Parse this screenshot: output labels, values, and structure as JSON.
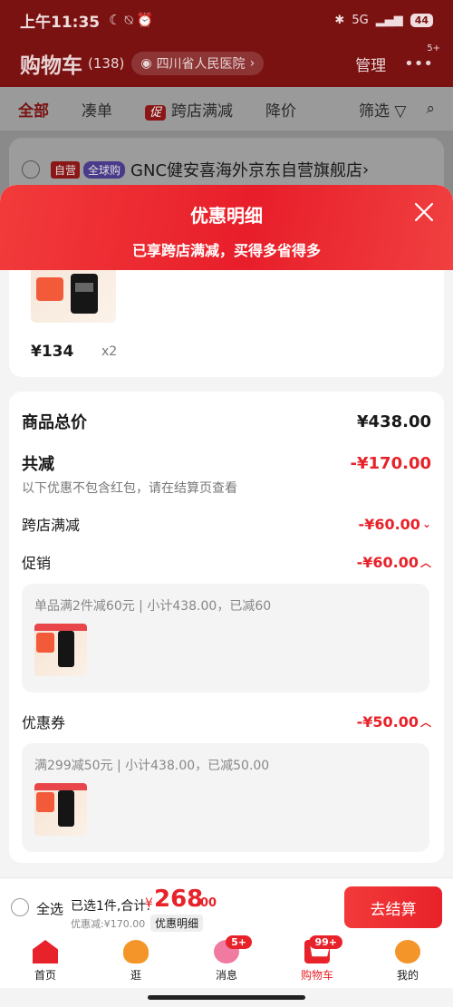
{
  "status_bar": {
    "time": "上午11:35",
    "network": "5G",
    "battery": "44"
  },
  "header": {
    "title": "购物车",
    "count": "(138)",
    "location": "四川省人民医院",
    "manage": "管理",
    "more_badge": "5+"
  },
  "tabs": [
    {
      "label": "全部"
    },
    {
      "label": "凑单"
    },
    {
      "label": "跨店满减",
      "tag": "促"
    },
    {
      "label": "降价"
    }
  ],
  "filter_label": "筛选",
  "store": {
    "tag_self": "自营",
    "tag_global": "全球购",
    "name": "GNC健安喜海外京东自营旗舰店"
  },
  "sheet": {
    "title": "优惠明细",
    "subtitle": "已享跨店满减，买得多省得多",
    "item": {
      "price": "¥134",
      "qty": "x2"
    },
    "total_label": "商品总价",
    "total_value": "¥438.00",
    "reduce_label": "共减",
    "reduce_value": "-¥170.00",
    "note": "以下优惠不包含红包，请在结算页查看",
    "cross_label": "跨店满减",
    "cross_value": "-¥60.00",
    "promo_label": "促销",
    "promo_value": "-¥60.00",
    "promo_desc": "单品满2件减60元 | 小计438.00，已减60",
    "coupon_label": "优惠券",
    "coupon_value": "-¥50.00",
    "coupon_desc": "满299减50元 | 小计438.00，已减50.00"
  },
  "checkout": {
    "select_all": "全选",
    "selected": "已选1件,合计:",
    "yen": "¥",
    "total": "268",
    "decimal": ".00",
    "discount": "优惠减:¥170.00",
    "detail_link": "优惠明细",
    "pay": "去结算"
  },
  "tabbar": [
    {
      "label": "首页"
    },
    {
      "label": "逛"
    },
    {
      "label": "消息",
      "badge": "5+"
    },
    {
      "label": "购物车",
      "badge": "99+"
    },
    {
      "label": "我的"
    }
  ],
  "colors": {
    "accent": "#e8222a",
    "header_dark": "#7a1212"
  }
}
